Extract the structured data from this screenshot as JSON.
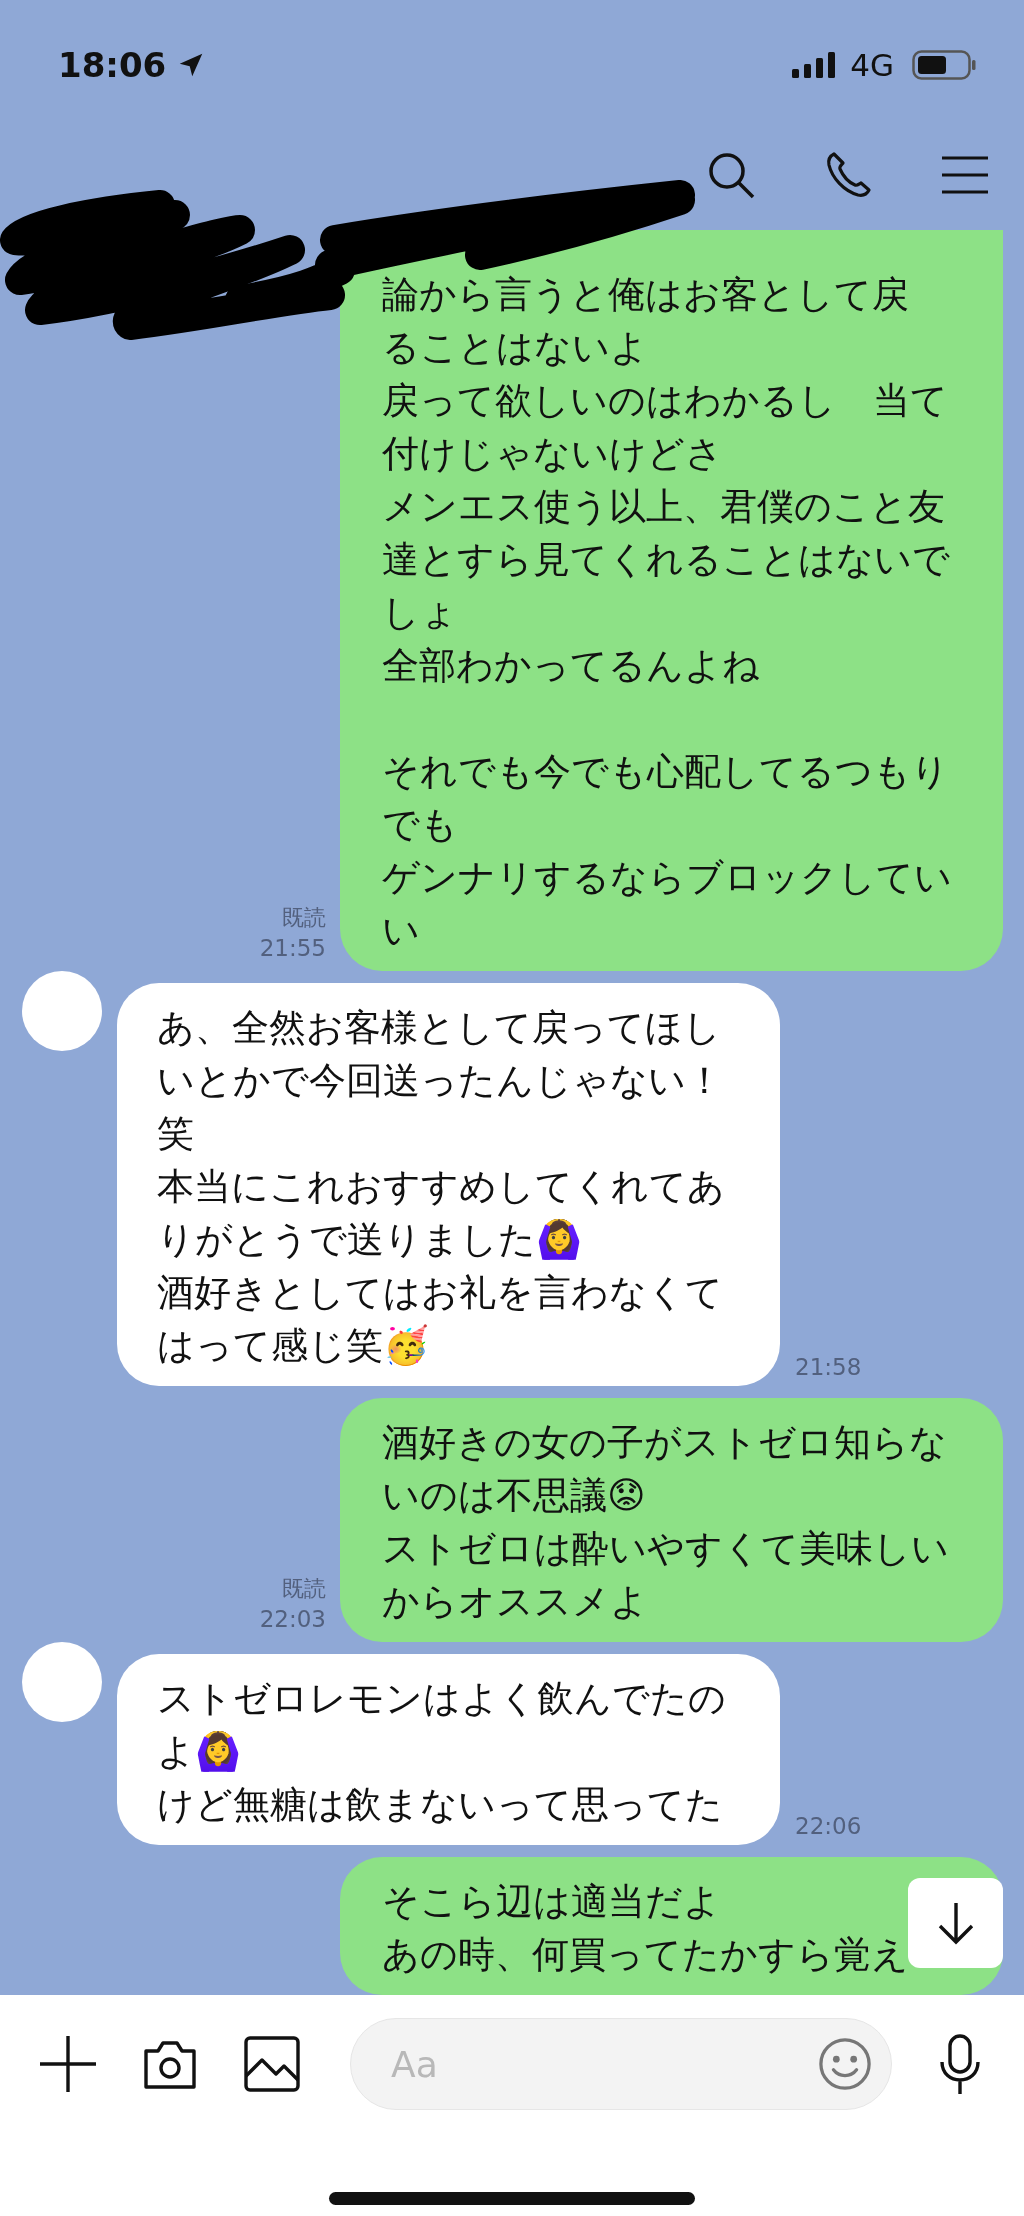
{
  "status_bar": {
    "time": "18:06",
    "network": "4G"
  },
  "messages": [
    {
      "kind": "sent",
      "paragraphs": [
        [
          "論から言うと俺はお客として戻",
          "ることはないよ",
          "戻って欲しいのはわかるし　当て",
          "付けじゃないけどさ",
          "メンエス使う以上、君僕のこと友",
          "達とすら見てくれることはないで",
          "しょ",
          "全部わかってるんよね"
        ],
        [
          "それでも今でも心配してるつもり",
          "でも",
          "ゲンナリするならブロックしてい",
          "い"
        ]
      ],
      "read": "既読",
      "time": "21:55"
    },
    {
      "kind": "received",
      "paragraphs": [
        [
          "あ、全然お客様として戻ってほし",
          "いとかで今回送ったんじゃない！",
          "笑",
          "本当にこれおすすめしてくれてあ",
          "りがとうで送りました🙆‍♀️",
          "酒好きとしてはお礼を言わなくて",
          "はって感じ笑🥳"
        ]
      ],
      "time": "21:58"
    },
    {
      "kind": "sent",
      "paragraphs": [
        [
          "酒好きの女の子がストゼロ知らな",
          "いのは不思議😟",
          "ストゼロは酔いやすくて美味しい",
          "からオススメよ"
        ]
      ],
      "read": "既読",
      "time": "22:03"
    },
    {
      "kind": "received",
      "paragraphs": [
        [
          "ストゼロレモンはよく飲んでたの",
          "よ🙆‍♀️",
          "けど無糖は飲まないって思ってた"
        ]
      ],
      "time": "22:06"
    },
    {
      "kind": "sent",
      "paragraphs": [
        [
          "そこら辺は適当だよ",
          "あの時、何買ってたかすら覚え"
        ]
      ]
    }
  ],
  "input": {
    "placeholder": "Aa"
  }
}
